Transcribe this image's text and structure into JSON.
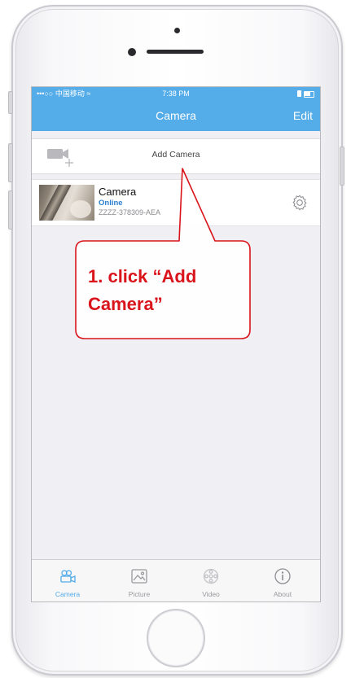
{
  "statusbar": {
    "carrier": "•••○○ 中国移动 ≈",
    "time": "7:38 PM"
  },
  "navbar": {
    "title": "Camera",
    "edit": "Edit"
  },
  "add_camera": {
    "label": "Add Camera",
    "icon": "video-camera-add-icon"
  },
  "cameras": [
    {
      "name": "Camera",
      "status": "Online",
      "uid": "ZZZZ-378309-AEA",
      "settings_icon": "gear-icon"
    }
  ],
  "tabs": [
    {
      "label": "Camera",
      "icon": "camera-tab-icon",
      "active": true
    },
    {
      "label": "Picture",
      "icon": "picture-icon",
      "active": false
    },
    {
      "label": "Video",
      "icon": "video-reel-icon",
      "active": false
    },
    {
      "label": "About",
      "icon": "info-icon",
      "active": false
    }
  ],
  "callout": {
    "line1": "1. click “Add",
    "line2": "Camera”"
  },
  "colors": {
    "accent": "#54ace8",
    "callout": "#d9141b",
    "online": "#2a7fd0"
  }
}
